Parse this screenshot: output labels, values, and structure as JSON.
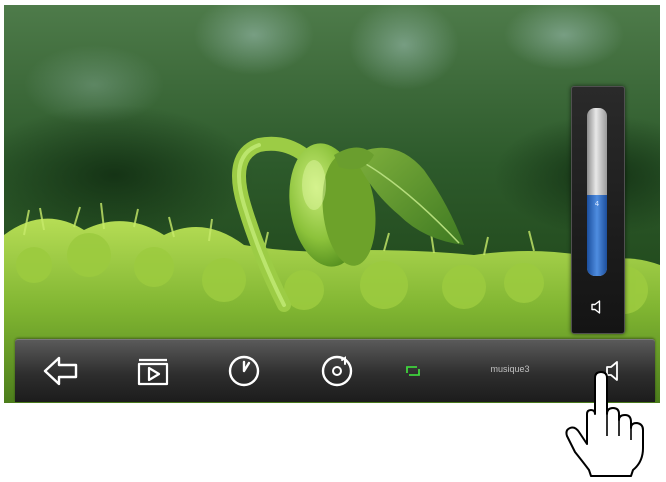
{
  "toolbar": {
    "buttons": [
      {
        "name": "back",
        "icon": "back-arrow-icon"
      },
      {
        "name": "slideshow",
        "icon": "play-icon"
      },
      {
        "name": "clock",
        "icon": "clock-icon"
      },
      {
        "name": "music",
        "icon": "music-disc-icon"
      },
      {
        "name": "repeat",
        "icon": "repeat-icon"
      },
      {
        "name": "volume",
        "icon": "speaker-icon"
      }
    ],
    "track_name": "musique3"
  },
  "volume_popup": {
    "level_value": "4",
    "level_fraction": 0.48,
    "icon": "speaker-icon"
  },
  "colors": {
    "icon_white": "#ffffff",
    "repeat_green": "#3fd13c",
    "volume_fill": "#3a76cf"
  },
  "pointer": {
    "icon": "hand-pointer-icon"
  }
}
